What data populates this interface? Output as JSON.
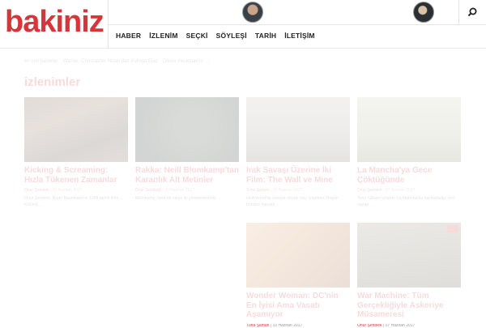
{
  "header": {
    "logo_text": "bakiniz",
    "nav": [
      "HABER",
      "İZLENİM",
      "SEÇKİ",
      "SÖYLEŞİ",
      "TARİH",
      "İLETİŞİM"
    ]
  },
  "breadcrumb": [
    "en son haberler",
    "Warner, Christopher Nolan'dan Pullopa Elaz",
    "Olivier Heckman'ın",
    "›"
  ],
  "page_title": "izlenimler",
  "cards": [
    {
      "title": "Kicking & Screaming: Hızla Tükenen Zamanlar",
      "author": "Onur Şenbiek",
      "date": "24 Haziran 2017",
      "excerpt": "Onur Şenbiek, Noah Baumbach'ın 1995 tarihli filmi ... Kicking ..."
    },
    {
      "title": "Rakka: Neill Blomkamp'tan Karanlık Alt Metinler",
      "author": "Onur Sondağlı",
      "date": "20 Haziran 2017",
      "excerpt": "Blomkamp, hem de sıkça iki yönetmenin de ..."
    },
    {
      "title": "Irak Savaşı Üzerine İki Film: The Wall ve Mine",
      "author": "Tuna Şaman",
      "date": "19 Haziran 2017",
      "excerpt": "Hollywood'da savaşa dönük olay çıkarken, Bugün bunlara karşılık ..."
    },
    {
      "title": "La Mancha'ya Gece Çöktüğünde",
      "author": "Onur Şenbiek",
      "date": "17 Haziran 2017",
      "excerpt": "Terry Gilliam yıllardır La Mancha'da kaybolduğu, son olarak ..."
    },
    {
      "title": "Wonder Woman: DC'nin En İyisi Ama Vasatı Aşamıyor",
      "author": "Tuna Şaman",
      "date": "10 Haziran 2017",
      "excerpt": ""
    },
    {
      "title": "War Machine: Tüm Gerçekliğiyle Askeriye Müsameresi",
      "author": "Onur Şenbiek",
      "date": "07 Haziran 2017",
      "excerpt": ""
    }
  ]
}
